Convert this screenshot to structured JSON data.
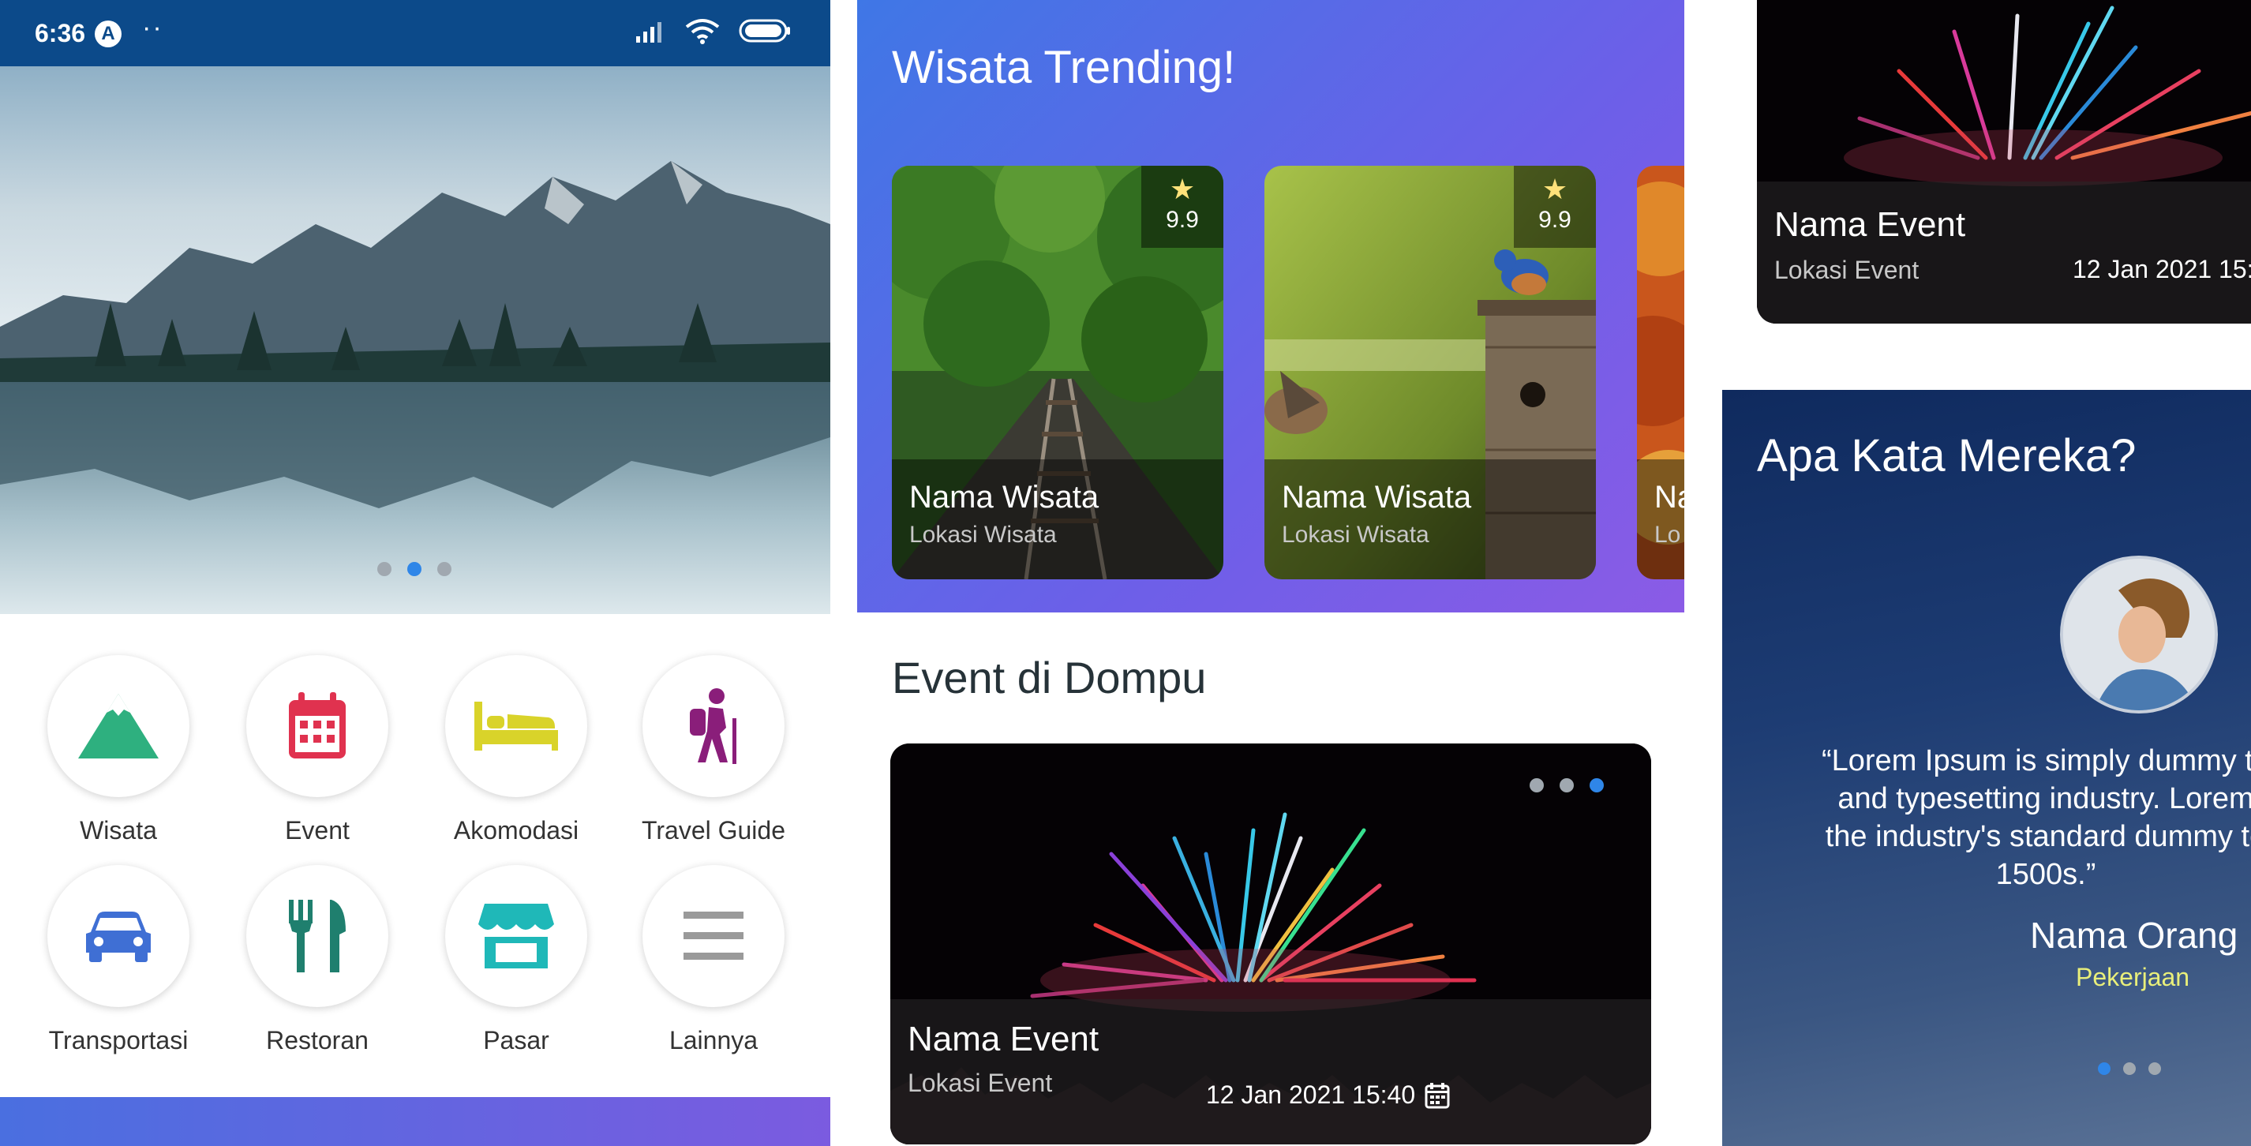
{
  "status_bar": {
    "time": "6:36",
    "badge": "A",
    "dots": "··"
  },
  "hero": {
    "slides": 3,
    "active_slide": 2
  },
  "menu": [
    {
      "label": "Wisata",
      "icon": "mountain-icon",
      "color": "#2eb07f"
    },
    {
      "label": "Event",
      "icon": "calendar-icon",
      "color": "#e0324f"
    },
    {
      "label": "Akomodasi",
      "icon": "bed-icon",
      "color": "#d9d32a"
    },
    {
      "label": "Travel Guide",
      "icon": "hiker-icon",
      "color": "#8a1e7a"
    },
    {
      "label": "Transportasi",
      "icon": "car-icon",
      "color": "#3f6fd4"
    },
    {
      "label": "Restoran",
      "icon": "utensils-icon",
      "color": "#1f7f6e"
    },
    {
      "label": "Pasar",
      "icon": "store-icon",
      "color": "#1fb8b8"
    },
    {
      "label": "Lainnya",
      "icon": "menu-icon",
      "color": "#9a9a9a"
    }
  ],
  "trending": {
    "title": "Wisata Trending!",
    "cards": [
      {
        "name": "Nama Wisata",
        "location": "Lokasi Wisata",
        "rating": "9.9"
      },
      {
        "name": "Nama Wisata",
        "location": "Lokasi Wisata",
        "rating": "9.9"
      },
      {
        "name": "Na",
        "location": "Lo",
        "rating": ""
      }
    ]
  },
  "events": {
    "title": "Event di Dompu",
    "card": {
      "name": "Nama Event",
      "location": "Lokasi Event",
      "date": "12 Jan 2021 15:40",
      "slides": 3,
      "active_slide": 3
    }
  },
  "p3_event": {
    "name": "Nama Event",
    "location": "Lokasi Event",
    "date": "12 Jan 2021 15:"
  },
  "testimonial": {
    "title": "Apa Kata Mereka?",
    "quote_lines": [
      "“Lorem Ipsum is simply dummy te",
      "and typesetting industry. Lorem",
      "the industry's standard dummy te",
      "1500s.”"
    ],
    "name": "Nama Orang",
    "job": "Pekerjaan",
    "slides": 3,
    "active_slide": 1
  }
}
